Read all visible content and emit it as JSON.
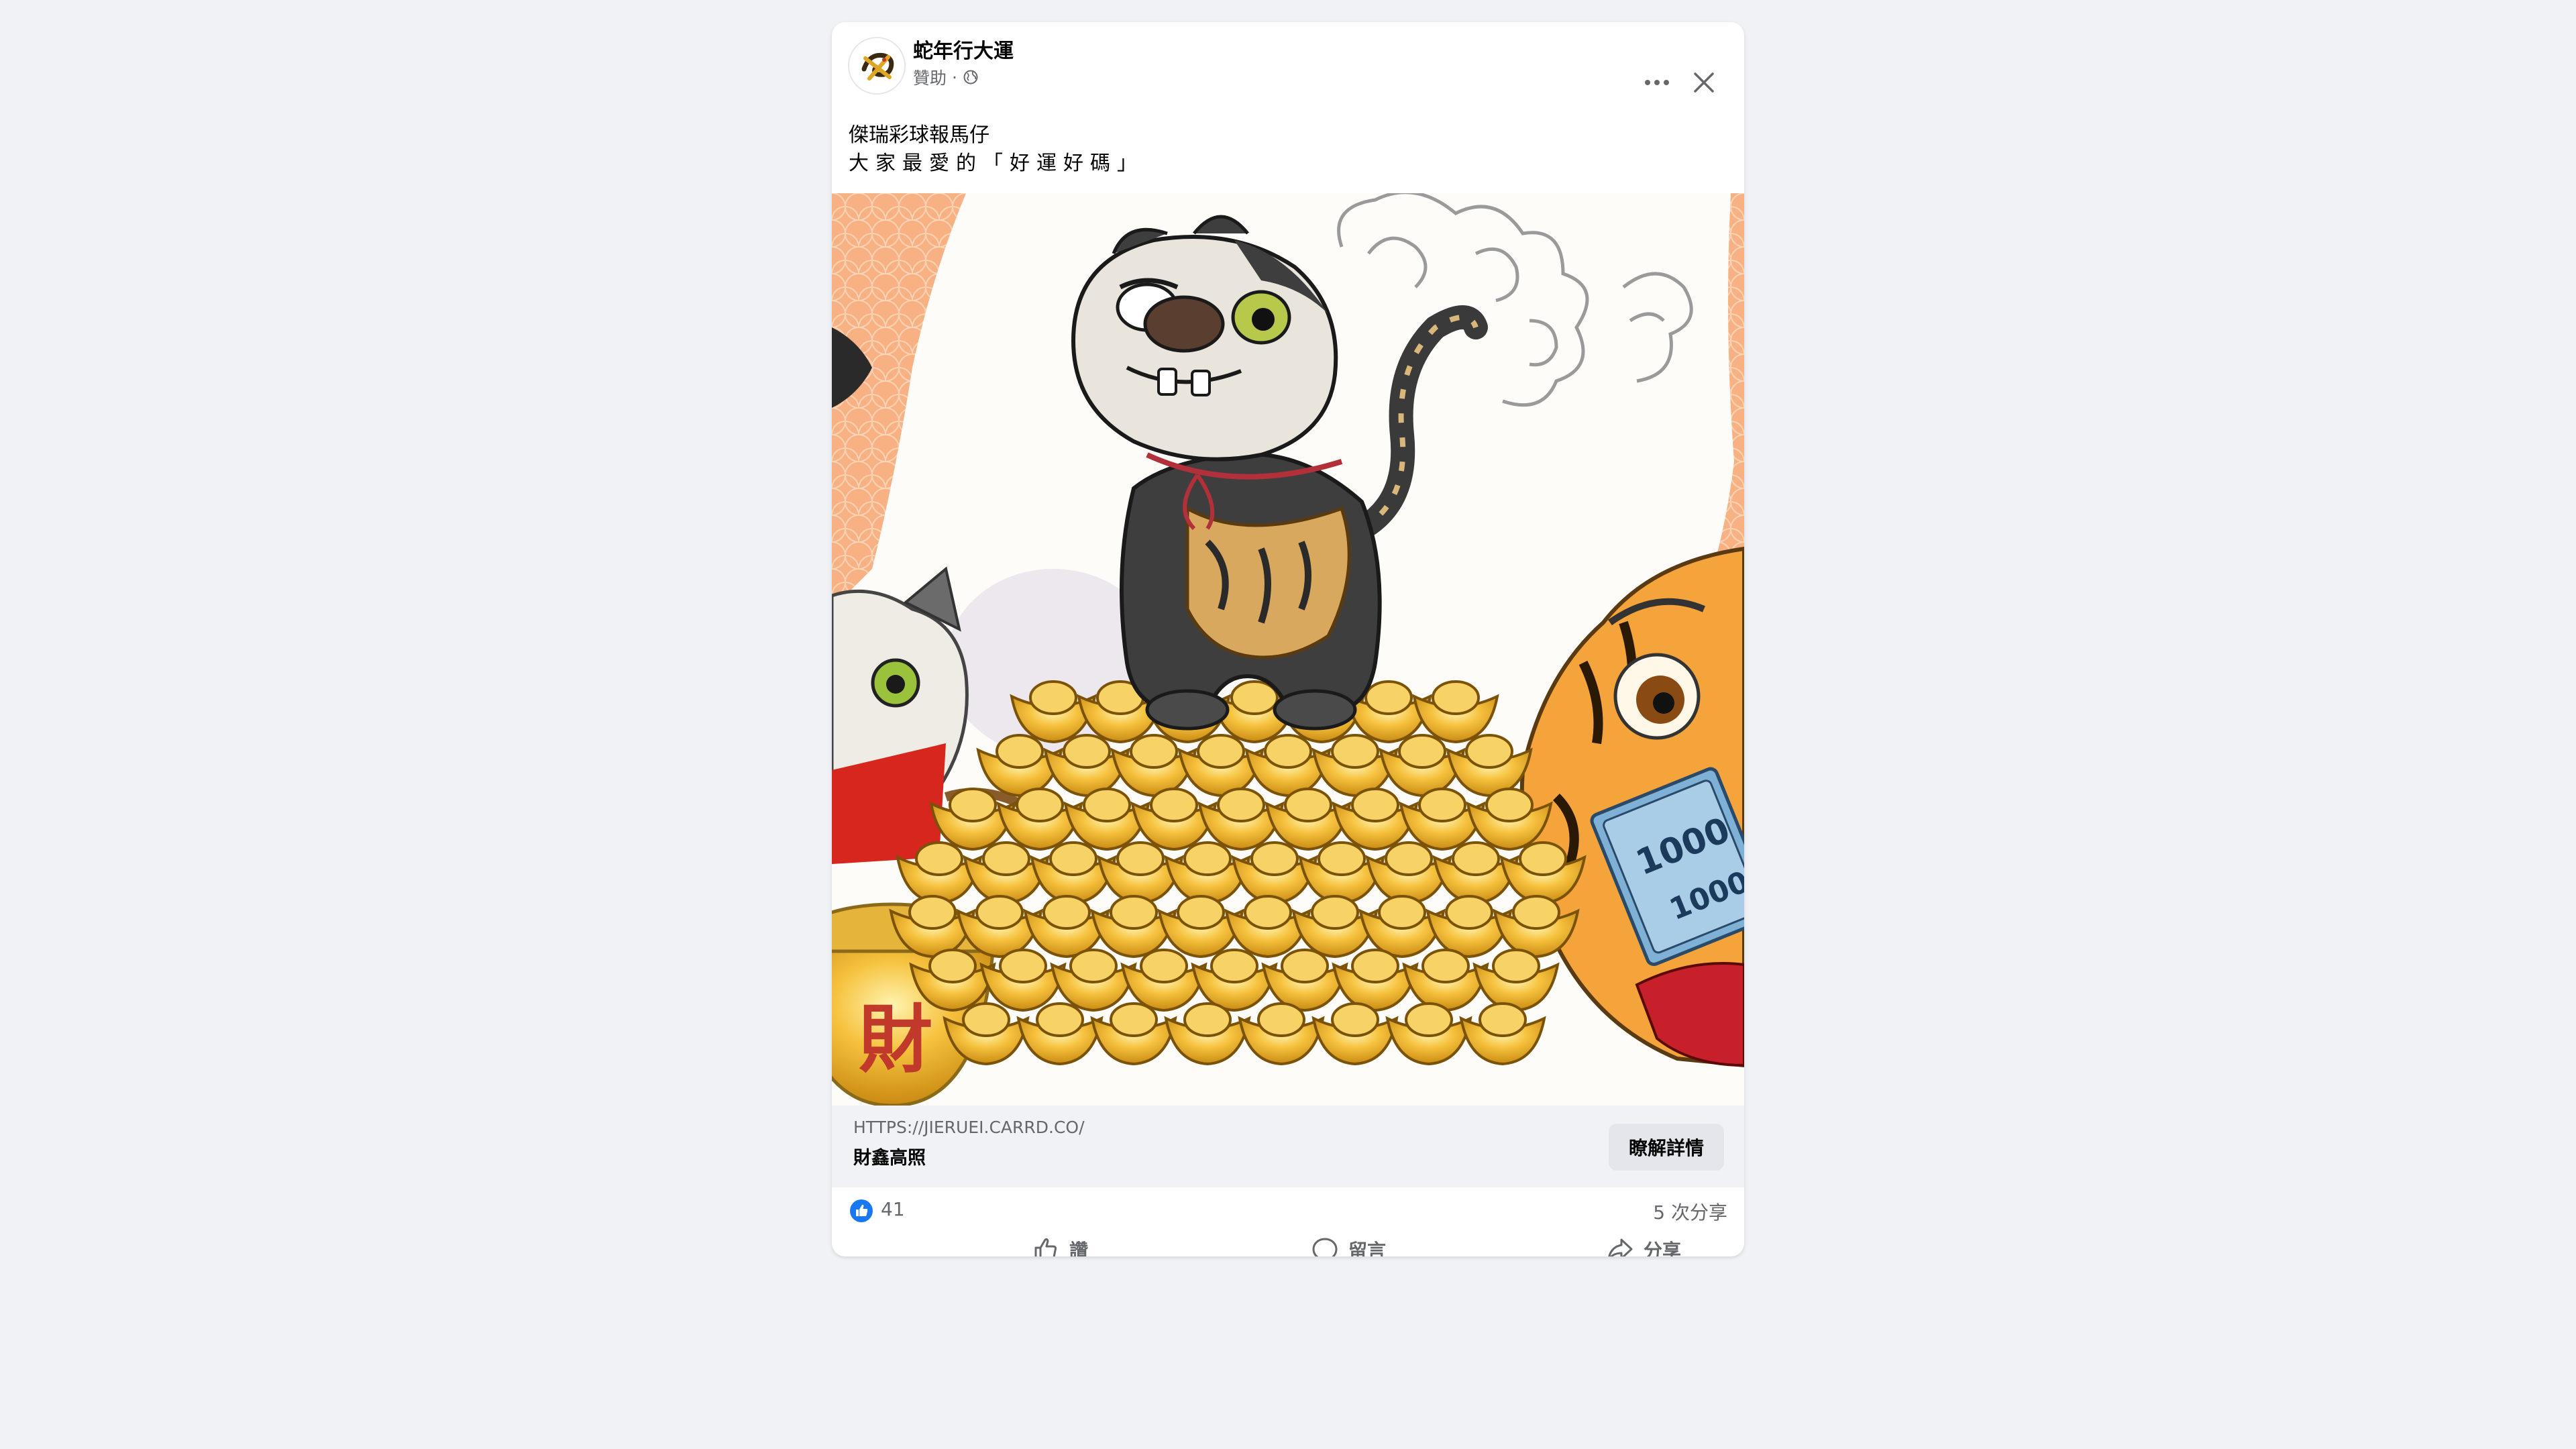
{
  "post": {
    "page_name": "蛇年行大運",
    "sponsored_label": "贊助",
    "separator": "·",
    "text_line1": "傑瑞彩球報馬仔",
    "text_line2": "大家最愛的「好運好碼」"
  },
  "link_preview": {
    "domain": "HTTPS://JIERUEI.CARRD.CO/",
    "title": "財鑫高照",
    "cta_label": "瞭解詳情"
  },
  "artwork": {
    "money_text_1": "1000",
    "money_text_2": "1000",
    "pot_character": "財"
  },
  "stats": {
    "like_count": "41",
    "share_count": "5 次分享"
  },
  "actions": {
    "like_label": "讚",
    "comment_label": "留言",
    "share_label": "分享"
  },
  "colors": {
    "accent_blue": "#1877f2",
    "background": "#f0f2f5",
    "card": "#ffffff",
    "text_secondary": "#65676b",
    "gold": "#f2b632",
    "peach": "#f7b183"
  },
  "icons": {
    "like_badge": "thumbs-up-icon",
    "globe": "globe-icon",
    "more": "more-horizontal-icon",
    "close": "close-icon",
    "like": "thumbs-up-outline-icon",
    "comment": "comment-bubble-icon",
    "share": "share-arrow-icon"
  }
}
